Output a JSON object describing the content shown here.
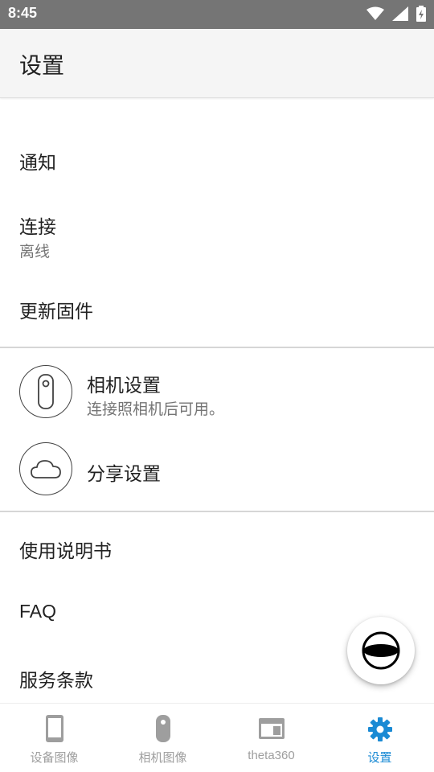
{
  "status_bar": {
    "time": "8:45"
  },
  "header": {
    "title": "设置"
  },
  "settings": {
    "notifications": "通知",
    "connection": {
      "label": "连接",
      "status": "离线"
    },
    "firmware_update": "更新固件",
    "camera_settings": {
      "label": "相机设置",
      "subtitle": "连接照相机后可用。"
    },
    "share_settings": "分享设置",
    "user_manual": "使用说明书",
    "faq": "FAQ",
    "terms": "服务条款"
  },
  "bottom_nav": {
    "items": [
      {
        "label": "设备图像",
        "icon": "phone-icon",
        "active": false
      },
      {
        "label": "相机图像",
        "icon": "camera-icon",
        "active": false
      },
      {
        "label": "theta360",
        "icon": "browser-icon",
        "active": false
      },
      {
        "label": "设置",
        "icon": "gear-icon",
        "active": true
      }
    ]
  },
  "colors": {
    "accent": "#1a8ad4",
    "status_bar": "#757575",
    "app_bar": "#f5f5f5"
  }
}
